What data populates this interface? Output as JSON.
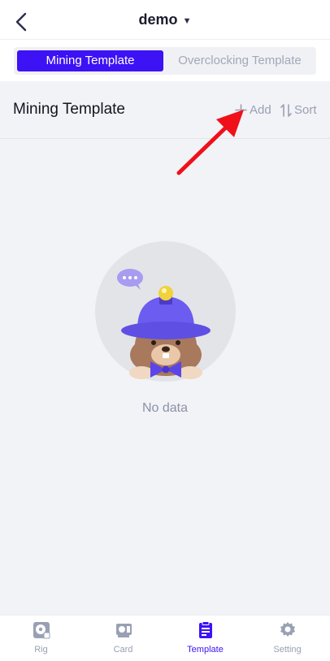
{
  "header": {
    "title": "demo",
    "back_icon": "chevron-left-icon",
    "dropdown_icon": "caret-down-icon"
  },
  "tabs_top": [
    {
      "label": "Mining Template",
      "active": true
    },
    {
      "label": "Overclocking Template",
      "active": false
    }
  ],
  "section": {
    "title": "Mining Template",
    "add_label": "Add",
    "sort_label": "Sort"
  },
  "empty": {
    "text": "No data"
  },
  "bottom_nav": [
    {
      "label": "Rig",
      "icon": "rig-icon",
      "active": false
    },
    {
      "label": "Card",
      "icon": "card-icon",
      "active": false
    },
    {
      "label": "Template",
      "icon": "template-icon",
      "active": true
    },
    {
      "label": "Setting",
      "icon": "gear-icon",
      "active": false
    }
  ],
  "colors": {
    "accent": "#3d12f5",
    "muted": "#9aa0b3",
    "annotation": "#f0101a"
  }
}
